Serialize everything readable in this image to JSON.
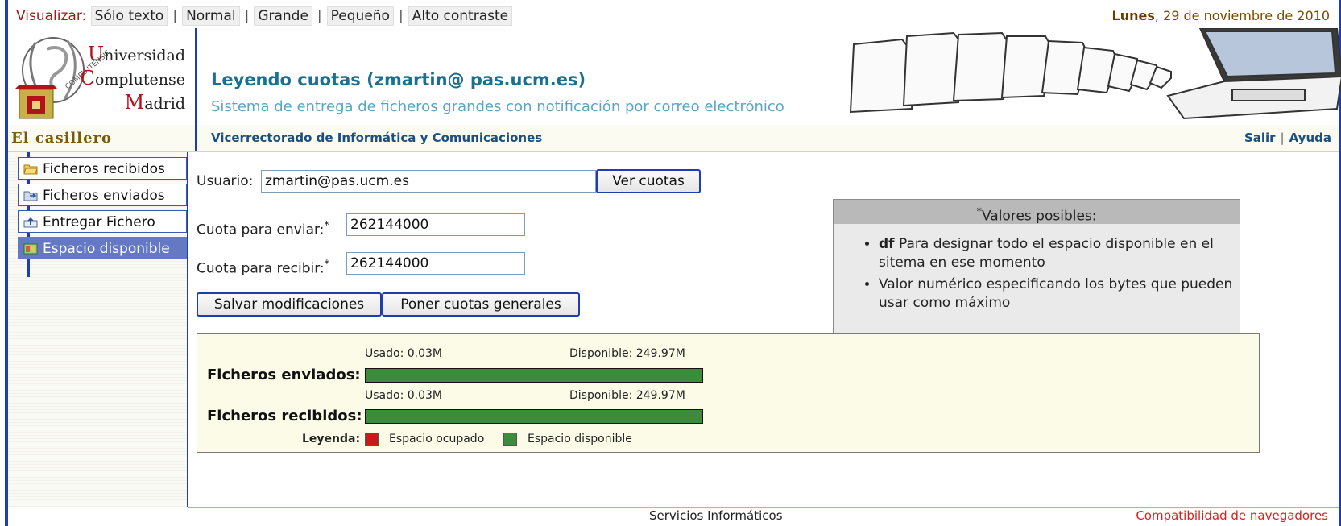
{
  "topbar": {
    "visualizar_label": "Visualizar:",
    "options": [
      "Sólo texto",
      "Normal",
      "Grande",
      "Pequeño",
      "Alto contraste"
    ],
    "date_day": "Lunes",
    "date_rest": ", 29 de noviembre de 2010"
  },
  "header": {
    "university": [
      "Universidad",
      "Complutense",
      "Madrid"
    ],
    "title": "Leyendo cuotas (zmartin@ pas.ucm.es)",
    "subtitle": "Sistema de entrega de ficheros grandes con notificación por correo electrónico"
  },
  "nav": {
    "section": "El casillero",
    "vicerrectorado": "Vicerrectorado de Informática y Comunicaciones",
    "salir": "Salir",
    "ayuda": "Ayuda",
    "sep": "|"
  },
  "sidebar": {
    "items": [
      {
        "label": "Ficheros recibidos",
        "icon": "folder-open-icon",
        "active": false
      },
      {
        "label": "Ficheros enviados",
        "icon": "sent-folder-icon",
        "active": false
      },
      {
        "label": "Entregar Fichero",
        "icon": "upload-icon",
        "active": false
      },
      {
        "label": "Espacio disponible",
        "icon": "disk-space-icon",
        "active": true
      }
    ]
  },
  "form": {
    "usuario_label": "Usuario:",
    "usuario_value": "zmartin@pas.ucm.es",
    "ver_cuotas": "Ver cuotas",
    "cuota_enviar_label": "Cuota para enviar:",
    "cuota_enviar_value": "262144000",
    "cuota_recibir_label": "Cuota para recibir:",
    "cuota_recibir_value": "262144000",
    "asterisk": "*",
    "salvar": "Salvar modificaciones",
    "poner_generales": "Poner cuotas generales"
  },
  "valores": {
    "title": "Valores posibles:",
    "items": [
      {
        "bold": "df",
        "text": " Para designar todo el espacio disponible en el sitema en ese momento"
      },
      {
        "bold": "",
        "text": "Valor numérico especificando los bytes que pueden usar como máximo"
      }
    ]
  },
  "usage": {
    "rows": [
      {
        "name": "Ficheros enviados:",
        "usado": "Usado: 0.03M",
        "disponible": "Disponible: 249.97M",
        "used_fraction": 0.0001
      },
      {
        "name": "Ficheros recibidos:",
        "usado": "Usado: 0.03M",
        "disponible": "Disponible: 249.97M",
        "used_fraction": 0.0001
      }
    ],
    "legend_label": "Leyenda:",
    "legend_ocupado": "Espacio ocupado",
    "legend_disponible": "Espacio disponible",
    "color_ocupado": "#c81a1a",
    "color_disponible": "#3c8c3c"
  },
  "footer": {
    "center": "Servicios Informáticos",
    "compat": "Compatibilidad de navegadores"
  }
}
